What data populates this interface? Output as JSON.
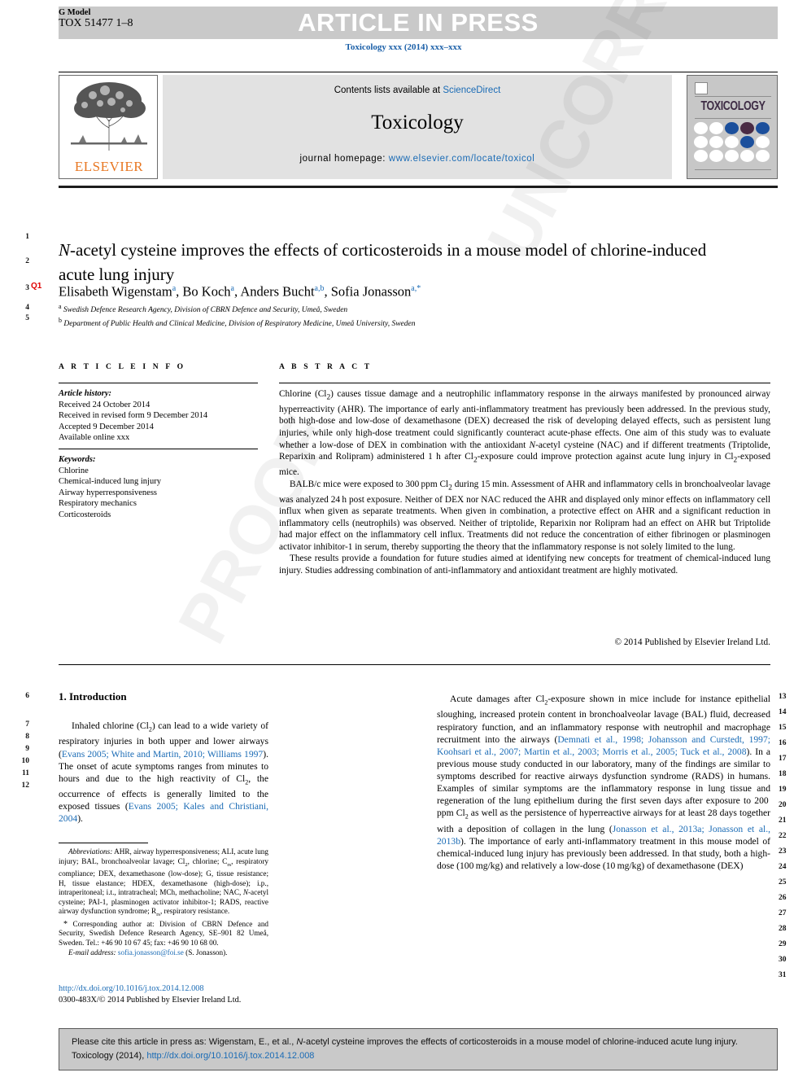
{
  "header": {
    "g_model_label": "G Model",
    "g_model_code": "TOX 51477 1–8",
    "article_in_press": "ARTICLE IN PRESS",
    "journal_ref": "Toxicology xxx (2014) xxx–xxx"
  },
  "masthead": {
    "contents_prefix": "Contents lists available at ",
    "sciencedirect": "ScienceDirect",
    "journal_title": "Toxicology",
    "homepage_label": "journal homepage: ",
    "homepage_url": "www.elsevier.com/locate/toxicol",
    "publisher": "ELSEVIER",
    "cover_title": "TOXICOLOGY"
  },
  "article": {
    "title_line1_pre": "",
    "title_italic": "N",
    "title_rest": "-acetyl cysteine improves the effects of corticosteroids in a mouse model of chlorine-induced acute lung injury",
    "query_tag": "Q1",
    "authors": "Elisabeth Wigenstam , Bo Koch , Anders Bucht , Sofia Jonasson",
    "affiliation_a": "Swedish Defence Research Agency, Division of CBRN Defence and Security, Umeå, Sweden",
    "affiliation_b": "Department of Public Health and Clinical Medicine, Division of Respiratory Medicine, Umeå University, Sweden"
  },
  "article_info": {
    "heading": "A R T I C L E   I N F O",
    "history_label": "Article history:",
    "history": [
      "Received 24 October 2014",
      "Received in revised form 9 December 2014",
      "Accepted 9 December 2014",
      "Available online xxx"
    ],
    "keywords_label": "Keywords:",
    "keywords": [
      "Chlorine",
      "Chemical-induced lung injury",
      "Airway hyperresponsiveness",
      "Respiratory mechanics",
      "Corticosteroids"
    ]
  },
  "abstract": {
    "heading": "A B S T R A C T",
    "p1": "Chlorine (Cl2) causes tissue damage and a neutrophilic inflammatory response in the airways manifested by pronounced airway hyperreactivity (AHR). The importance of early anti-inflammatory treatment has previously been addressed. In the previous study, both high-dose and low-dose of dexamethasone (DEX) decreased the risk of developing delayed effects, such as persistent lung injuries, while only high-dose treatment could significantly counteract acute-phase effects. One aim of this study was to evaluate whether a low-dose of DEX in combination with the antioxidant N-acetyl cysteine (NAC) and if different treatments (Triptolide, Reparixin and Rolipram) administered 1 h after Cl2-exposure could improve protection against acute lung injury in Cl2-exposed mice.",
    "p2": "BALB/c mice were exposed to 300 ppm Cl2 during 15 min. Assessment of AHR and inflammatory cells in bronchoalveolar lavage was analyzed 24 h post exposure. Neither of DEX nor NAC reduced the AHR and displayed only minor effects on inflammatory cell influx when given as separate treatments. When given in combination, a protective effect on AHR and a significant reduction in inflammatory cells (neutrophils) was observed. Neither of triptolide, Reparixin nor Rolipram had an effect on AHR but Triptolide had major effect on the inflammatory cell influx. Treatments did not reduce the concentration of either fibrinogen or plasminogen activator inhibitor-1 in serum, thereby supporting the theory that the inflammatory response is not solely limited to the lung.",
    "p3": "These results provide a foundation for future studies aimed at identifying new concepts for treatment of chemical-induced lung injury. Studies addressing combination of anti-inflammatory and antioxidant treatment are highly motivated.",
    "copyright": "© 2014 Published by Elsevier Ireland Ltd."
  },
  "introduction": {
    "heading": "1. Introduction",
    "left_p1_a": "Inhaled chlorine (Cl2) can lead to a wide variety of respiratory injuries in both upper and lower airways (",
    "left_ref1": "Evans 2005; White and Martin, 2010; Williams 1997",
    "left_p1_b": "). The onset of acute symptoms ranges from minutes to hours and due to the high reactivity of Cl2, the occurrence of effects is generally limited to the exposed tissues (",
    "left_ref2": "Evans 2005; Kales and Christiani, 2004",
    "left_p1_c": ").",
    "right_p1_a": "Acute damages after Cl2-exposure shown in mice include for instance epithelial sloughing, increased protein content in bronchoalveolar lavage (BAL) fluid, decreased respiratory function, and an inflammatory response with neutrophil and macrophage recruitment into the airways (",
    "right_ref1": "Demnati et al., 1998; Johansson and Curstedt, 1997; Koohsari et al., 2007; Martin et al., 2003; Morris et al., 2005; Tuck et al., 2008",
    "right_p1_b": "). In a previous mouse study conducted in our laboratory, many of the findings are similar to symptoms described for reactive airways dysfunction syndrome (RADS) in humans. Examples of similar symptoms are the inflammatory response in lung tissue and regeneration of the lung epithelium during the first seven days after exposure to 200 ppm Cl2 as well as the persistence of hyperreactive airways for at least 28 days together with a deposition of collagen in the lung (",
    "right_ref2": "Jonasson et al., 2013a; Jonasson et al., 2013b",
    "right_p1_c": "). The importance of early anti-inflammatory treatment in this mouse model of chemical-induced lung injury has previously been addressed. In that study, both a high-dose (100 mg/kg) and relatively a low-dose (10 mg/kg) of dexamethasone (DEX)"
  },
  "footnote": {
    "abbrev_label": "Abbreviations:",
    "abbrev_text": " AHR, airway hyperresponsiveness; ALI, acute lung injury; BAL, bronchoalveolar lavage; Cl2, chlorine; Crs, respiratory compliance; DEX, dexamethasone (low-dose); G, tissue resistance; H, tissue elastance; HDEX, dexamethasone (high-dose); i.p., intraperitoneal; i.t., intratracheal; MCh, methacholine; NAC, N-acetyl cysteine; PAI-1, plasminogen activator inhibitor-1; RADS, reactive airway dysfunction syndrome; Rrs, respiratory resistance.",
    "corresponding": "Corresponding author at: Division of CBRN Defence and Security, Swedish Defence Research Agency, SE–901 82 Umeå, Sweden. Tel.: +46 90 10 67 45; fax: +46 90 10 68 00.",
    "email_label": "E-mail address:",
    "email": "sofia.jonasson@foi.se",
    "email_suffix": " (S. Jonasson).",
    "doi_url": "http://dx.doi.org/10.1016/j.tox.2014.12.008",
    "issn_line": "0300-483X/© 2014 Published by Elsevier Ireland Ltd."
  },
  "citation_footer": {
    "text_pre": "Please cite this article in press as: Wigenstam, E., et al., ",
    "text_italic": "N",
    "text_mid": "-acetyl cysteine improves the effects of corticosteroids in a mouse model of chlorine-induced acute lung injury. Toxicology (2014), ",
    "doi": "http://dx.doi.org/10.1016/j.tox.2014.12.008"
  },
  "line_numbers": {
    "left": [
      "1",
      "2",
      "3",
      "4",
      "5",
      "6",
      "7",
      "8",
      "9",
      "10",
      "11",
      "12"
    ],
    "right": [
      "13",
      "14",
      "15",
      "16",
      "17",
      "18",
      "19",
      "20",
      "21",
      "22",
      "23",
      "24",
      "25",
      "26",
      "27",
      "28",
      "29",
      "30",
      "31"
    ]
  },
  "watermark": {
    "text1": "UNCORRECTED",
    "text2": "PROOF"
  },
  "colors": {
    "link": "#1a6bb5",
    "query": "#e00000",
    "elsevier_orange": "#e87722",
    "bar_gray": "#c9c9c9"
  }
}
